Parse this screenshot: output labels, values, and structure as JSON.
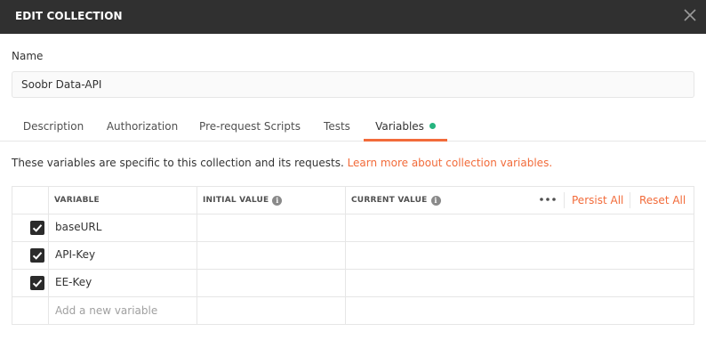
{
  "window": {
    "title": "EDIT COLLECTION"
  },
  "name_field": {
    "label": "Name",
    "value": "Soobr Data-API"
  },
  "tabs": [
    {
      "label": "Description"
    },
    {
      "label": "Authorization"
    },
    {
      "label": "Pre-request Scripts"
    },
    {
      "label": "Tests"
    },
    {
      "label": "Variables",
      "active": true,
      "indicator_color": "#26b47f"
    }
  ],
  "info": {
    "text": "These variables are specific to this collection and its requests. ",
    "link": "Learn more about collection variables."
  },
  "table": {
    "headers": {
      "variable": "VARIABLE",
      "initial": "INITIAL VALUE",
      "current": "CURRENT VALUE"
    },
    "actions": {
      "persist": "Persist All",
      "reset": "Reset All"
    },
    "rows": [
      {
        "variable": "baseURL",
        "enabled": true
      },
      {
        "variable": "API-Key",
        "enabled": true
      },
      {
        "variable": "EE-Key",
        "enabled": true
      }
    ],
    "new_placeholder": "Add a new variable"
  },
  "colors": {
    "accent": "#f26b3a",
    "titlebar": "#303030",
    "checkbox": "#2b2b2b"
  }
}
